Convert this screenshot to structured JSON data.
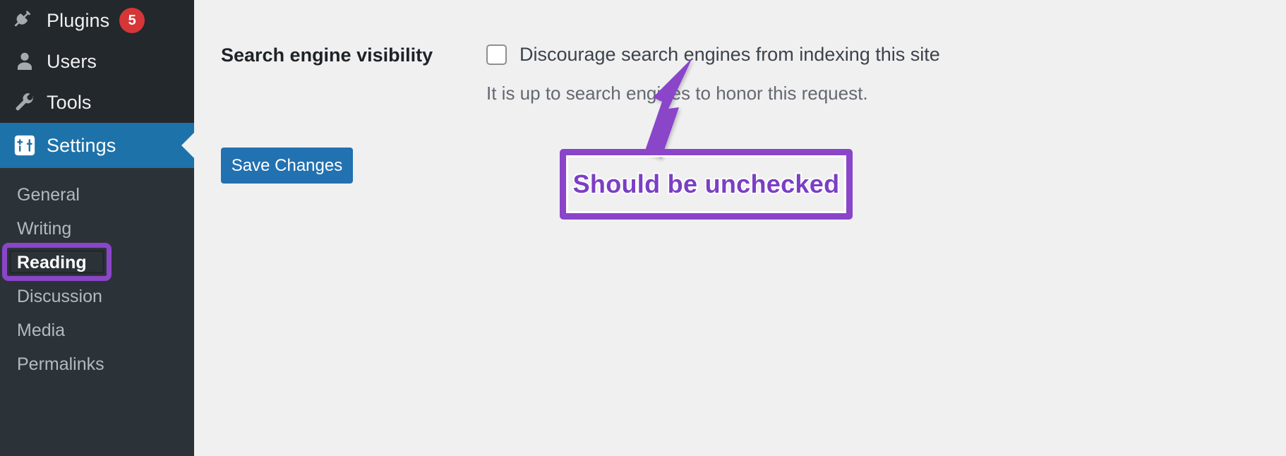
{
  "colors": {
    "sidebar_bg": "#2c3338",
    "sidebar_top_bg": "#23282d",
    "active_menu_bg": "#1d72aa",
    "badge_bg": "#d63638",
    "content_bg": "#f0f0f1",
    "button_bg": "#2271b1",
    "annotation_purple": "#8a45c9",
    "annotation_text": "#7b3fc4"
  },
  "sidebar": {
    "top_items": [
      {
        "label": "Plugins",
        "icon": "plugin-icon",
        "badge": "5"
      },
      {
        "label": "Users",
        "icon": "user-icon",
        "badge": ""
      },
      {
        "label": "Tools",
        "icon": "wrench-icon",
        "badge": ""
      }
    ],
    "active_item": {
      "label": "Settings",
      "icon": "settings-sliders-icon"
    },
    "submenu_items": [
      {
        "label": "General",
        "current": false
      },
      {
        "label": "Writing",
        "current": false
      },
      {
        "label": "Reading",
        "current": true
      },
      {
        "label": "Discussion",
        "current": false
      },
      {
        "label": "Media",
        "current": false
      },
      {
        "label": "Permalinks",
        "current": false
      }
    ]
  },
  "main": {
    "ghost_top_text": "",
    "field_label": "Search engine visibility",
    "checkbox_checked": false,
    "checkbox_label": "Discourage search engines from indexing this site",
    "field_description": "It is up to search engines to honor this request.",
    "save_button_label": "Save Changes"
  },
  "annotations": {
    "callout_text": "Should be unchecked",
    "arrow_target": "discourage-search-engines-checkbox",
    "reading_highlight_label": "Reading"
  }
}
